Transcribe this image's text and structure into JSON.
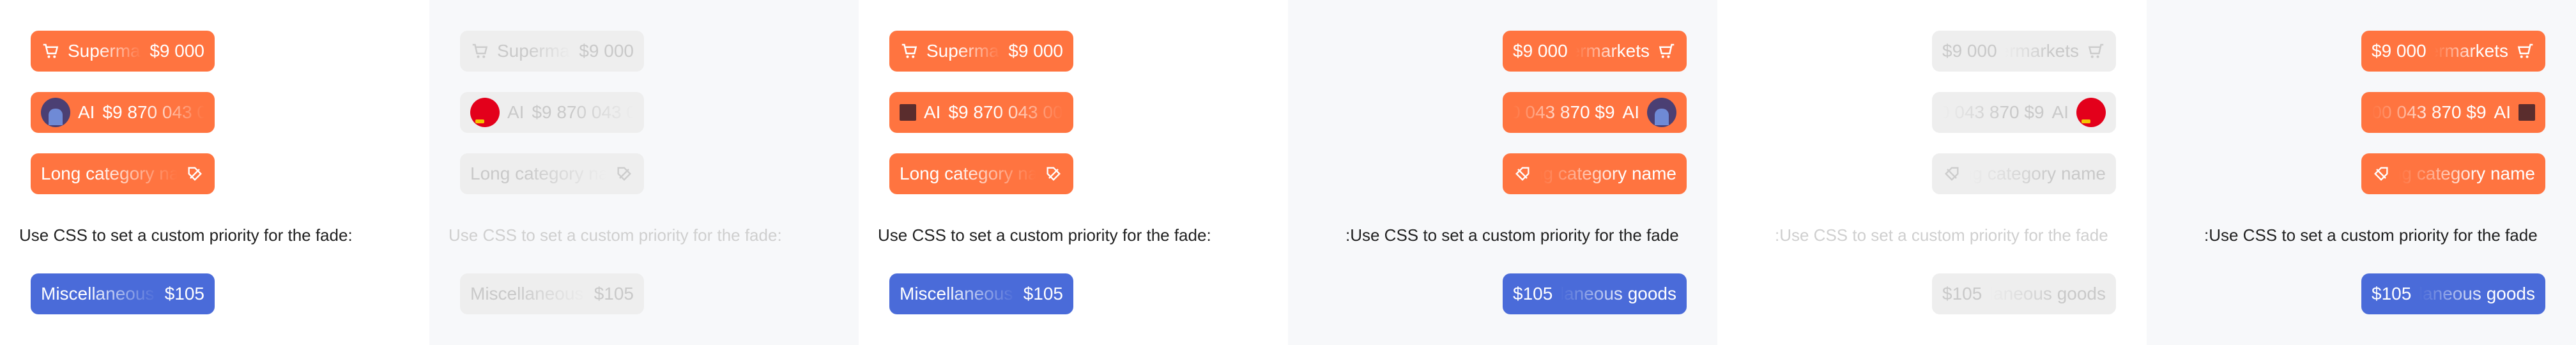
{
  "chips": {
    "supermarkets": "Supermarkets",
    "amount_short": "$9 000",
    "ai_label": "AI",
    "ai_amount": "$9 870 043 000",
    "long_category": "Long category name",
    "misc": "Miscellaneous goods",
    "misc_amount": "$105"
  },
  "caption": "Use CSS to set a custom priority for the fade:",
  "caption_mirror": ":Use CSS to set a custom priority for the fade",
  "icons": [
    "cart-icon",
    "avatar-icon",
    "flag-icon",
    "square-icon",
    "tag-icon"
  ],
  "colors": {
    "orange": "#ff7440",
    "blue": "#4a6bd9",
    "disabled": "#eeeeee"
  }
}
